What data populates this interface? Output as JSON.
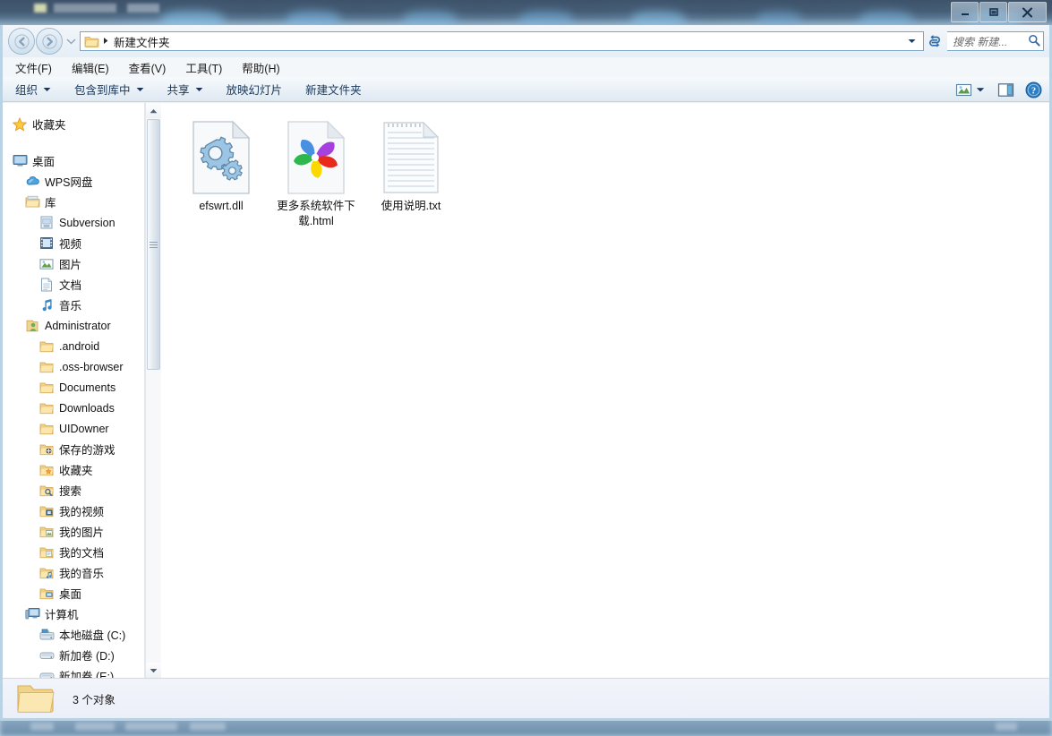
{
  "window": {
    "title": "新建文件夹",
    "controls": {
      "minimize": "最小化",
      "maximize": "最大化",
      "close": "关闭"
    }
  },
  "addressbar": {
    "back_label": "后退",
    "forward_label": "前进",
    "history_label": "最近浏览的位置",
    "breadcrumb": "新建文件夹",
    "dropdown_label": "下拉",
    "refresh_label": "刷新"
  },
  "search": {
    "placeholder": "搜索 新建...",
    "icon": "search-icon"
  },
  "menubar": {
    "items": [
      {
        "label": "文件(F)"
      },
      {
        "label": "编辑(E)"
      },
      {
        "label": "查看(V)"
      },
      {
        "label": "工具(T)"
      },
      {
        "label": "帮助(H)"
      }
    ]
  },
  "commandbar": {
    "items": [
      {
        "label": "组织",
        "has_caret": true
      },
      {
        "label": "包含到库中",
        "has_caret": true
      },
      {
        "label": "共享",
        "has_caret": true
      },
      {
        "label": "放映幻灯片",
        "has_caret": false
      },
      {
        "label": "新建文件夹",
        "has_caret": false
      }
    ],
    "right_icons": [
      {
        "name": "change-view-icon",
        "label": "更改您的视图"
      },
      {
        "name": "chevron-down-icon",
        "label": "视图下拉"
      },
      {
        "name": "preview-pane-icon",
        "label": "显示预览窗格"
      },
      {
        "name": "help-icon",
        "label": "帮助"
      }
    ]
  },
  "navpane": {
    "items": [
      {
        "label": "收藏夹",
        "icon": "star-icon",
        "level": 0
      },
      {
        "label": "桌面",
        "icon": "desktop-icon",
        "level": 0
      },
      {
        "label": "WPS网盘",
        "icon": "cloud-icon",
        "level": 1
      },
      {
        "label": "库",
        "icon": "library-icon",
        "level": 1
      },
      {
        "label": "Subversion",
        "icon": "subversion-icon",
        "level": 2
      },
      {
        "label": "视频",
        "icon": "video-icon",
        "level": 2
      },
      {
        "label": "图片",
        "icon": "pictures-icon",
        "level": 2
      },
      {
        "label": "文档",
        "icon": "documents-icon",
        "level": 2
      },
      {
        "label": "音乐",
        "icon": "music-icon",
        "level": 2
      },
      {
        "label": "Administrator",
        "icon": "user-icon",
        "level": 1
      },
      {
        "label": ".android",
        "icon": "folder-icon",
        "level": 2
      },
      {
        "label": ".oss-browser",
        "icon": "folder-icon",
        "level": 2
      },
      {
        "label": "Documents",
        "icon": "folder-icon",
        "level": 2
      },
      {
        "label": "Downloads",
        "icon": "folder-icon",
        "level": 2
      },
      {
        "label": "UIDowner",
        "icon": "folder-icon",
        "level": 2
      },
      {
        "label": "保存的游戏",
        "icon": "saved-games-icon",
        "level": 2
      },
      {
        "label": "收藏夹",
        "icon": "favorites-folder-icon",
        "level": 2
      },
      {
        "label": "搜索",
        "icon": "search-folder-icon",
        "level": 2
      },
      {
        "label": "我的视频",
        "icon": "my-videos-icon",
        "level": 2
      },
      {
        "label": "我的图片",
        "icon": "my-pictures-icon",
        "level": 2
      },
      {
        "label": "我的文档",
        "icon": "my-documents-icon",
        "level": 2
      },
      {
        "label": "我的音乐",
        "icon": "my-music-icon",
        "level": 2
      },
      {
        "label": "桌面",
        "icon": "desktop-folder-icon",
        "level": 2
      },
      {
        "label": "计算机",
        "icon": "computer-icon",
        "level": 1
      },
      {
        "label": "本地磁盘 (C:)",
        "icon": "system-drive-icon",
        "level": 2
      },
      {
        "label": "新加卷 (D:)",
        "icon": "drive-icon",
        "level": 2
      },
      {
        "label": "新加卷 (E:)",
        "icon": "drive-icon",
        "level": 2
      }
    ]
  },
  "files": {
    "items": [
      {
        "name": "efswrt.dll",
        "icon": "dll-gears-icon"
      },
      {
        "name": "更多系统软件下载.html",
        "icon": "html-pinwheel-icon"
      },
      {
        "name": "使用说明.txt",
        "icon": "text-document-icon"
      }
    ]
  },
  "statusbar": {
    "icon": "folder-icon",
    "text": "3 个对象"
  },
  "colors": {
    "accent": "#2b5d8c",
    "glass": "#3a5068",
    "frame": "#b9d3e5",
    "folder_yellow": "#f5d98c",
    "command_text": "#17365d"
  }
}
